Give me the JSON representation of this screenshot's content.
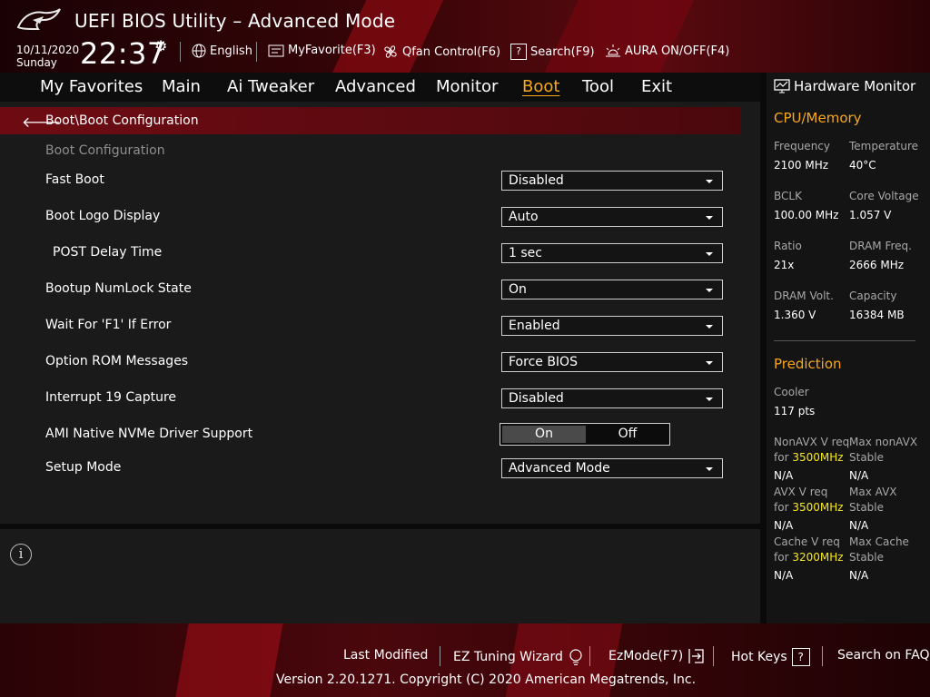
{
  "header": {
    "title": "UEFI BIOS Utility – Advanced Mode",
    "date": "10/11/2020",
    "day": "Sunday",
    "time": "22:37",
    "tools": {
      "language": "English",
      "myfavorite": "MyFavorite(F3)",
      "qfan": "Qfan Control(F6)",
      "search": "Search(F9)",
      "aura": "AURA ON/OFF(F4)"
    }
  },
  "menu": {
    "items": [
      "My Favorites",
      "Main",
      "Ai Tweaker",
      "Advanced",
      "Monitor",
      "Boot",
      "Tool",
      "Exit"
    ],
    "active": "Boot"
  },
  "main": {
    "breadcrumb": "Boot\\Boot Configuration",
    "section_title": "Boot Configuration",
    "settings": [
      {
        "label": "Fast Boot",
        "value": "Disabled"
      },
      {
        "label": "Boot Logo Display",
        "value": "Auto"
      },
      {
        "label": "POST Delay Time",
        "value": "1 sec"
      },
      {
        "label": "Bootup NumLock State",
        "value": "On"
      },
      {
        "label": "Wait For 'F1' If Error",
        "value": "Enabled"
      },
      {
        "label": "Option ROM Messages",
        "value": "Force BIOS"
      },
      {
        "label": "Interrupt 19 Capture",
        "value": "Disabled"
      },
      {
        "label": "AMI Native NVMe Driver Support",
        "on": "On",
        "off": "Off",
        "selected": "On"
      },
      {
        "label": "Setup Mode",
        "value": "Advanced Mode"
      }
    ]
  },
  "hardware_monitor": {
    "title": "Hardware Monitor",
    "cpu_memory": {
      "title": "CPU/Memory",
      "frequency_label": "Frequency",
      "frequency": "2100 MHz",
      "temperature_label": "Temperature",
      "temperature": "40°C",
      "bclk_label": "BCLK",
      "bclk": "100.00 MHz",
      "core_voltage_label": "Core Voltage",
      "core_voltage": "1.057 V",
      "ratio_label": "Ratio",
      "ratio": "21x",
      "dram_freq_label": "DRAM Freq.",
      "dram_freq": "2666 MHz",
      "dram_volt_label": "DRAM Volt.",
      "dram_volt": "1.360 V",
      "capacity_label": "Capacity",
      "capacity": "16384 MB"
    },
    "prediction": {
      "title": "Prediction",
      "cooler_label": "Cooler",
      "cooler": "117 pts",
      "nonavx_req_label": "NonAVX V req",
      "for_label": "for",
      "nonavx_freq": "3500MHz",
      "nonavx_req": "N/A",
      "max_nonavx_label": "Max nonAVX",
      "stable_label": "Stable",
      "max_nonavx": "N/A",
      "avx_req_label": "AVX V req",
      "avx_freq": "3500MHz",
      "avx_req": "N/A",
      "max_avx_label": "Max AVX",
      "max_avx": "N/A",
      "cache_req_label": "Cache V req",
      "cache_freq": "3200MHz",
      "cache_req": "N/A",
      "max_cache_label": "Max Cache",
      "max_cache": "N/A"
    }
  },
  "footer": {
    "last_modified": "Last Modified",
    "ez_tuning": "EZ Tuning Wizard",
    "ezmode": "EzMode(F7)",
    "hot_keys": "Hot Keys",
    "hot_keys_key": "?",
    "search_faq": "Search on FAQ",
    "copyright": "Version 2.20.1271. Copyright (C) 2020 American Megatrends, Inc."
  },
  "colors": {
    "accent": "#f7a81b",
    "highlight_freq": "#f7e81b",
    "breadcrumb_bar": "#6e0b12"
  },
  "icons": [
    "rog-logo",
    "gear-icon",
    "globe-icon",
    "favorite-icon",
    "fan-icon",
    "search-icon",
    "aura-icon",
    "back-arrow-icon",
    "dropdown-caret-icon",
    "info-icon",
    "monitor-icon",
    "lightbulb-icon",
    "exit-icon"
  ]
}
